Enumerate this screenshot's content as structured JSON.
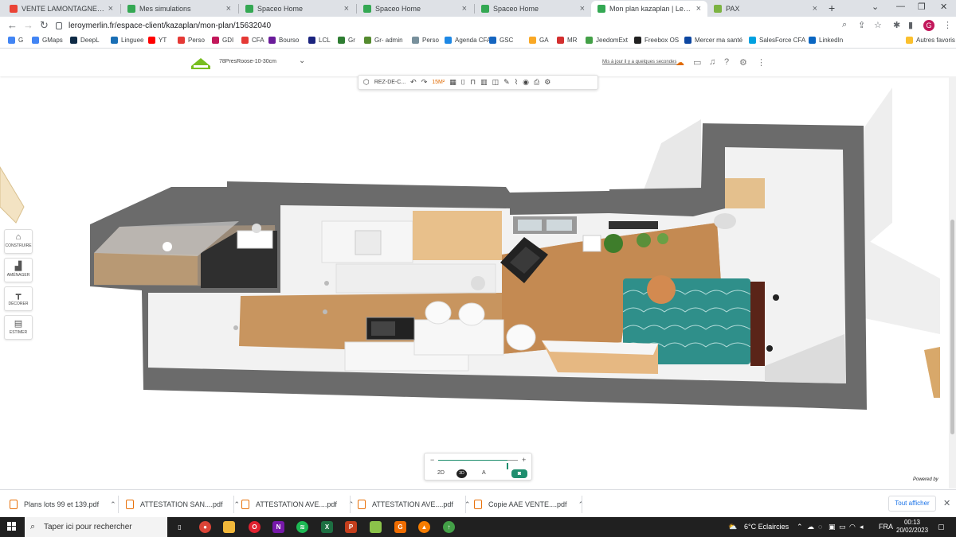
{
  "browser": {
    "tabs": [
      {
        "title": "VENTE LAMONTAGNE/GRAIGNIC",
        "favicon": "gmail-icon",
        "color": "#ea4335"
      },
      {
        "title": "Mes simulations",
        "favicon": "page-icon",
        "color": "#34a853"
      },
      {
        "title": "Spaceo Home",
        "favicon": "page-icon",
        "color": "#34a853"
      },
      {
        "title": "Spaceo Home",
        "favicon": "page-icon",
        "color": "#34a853"
      },
      {
        "title": "Spaceo Home",
        "favicon": "page-icon",
        "color": "#34a853"
      },
      {
        "title": "Mon plan kazaplan | Leroy Merl",
        "favicon": "page-icon",
        "color": "#34a853"
      },
      {
        "title": "PAX",
        "favicon": "pax-icon",
        "color": "#7cb342"
      }
    ],
    "url": "leroymerlin.fr/espace-client/kazaplan/mon-plan/15632040",
    "bookmarks": [
      {
        "label": "G",
        "color": "#4285f4"
      },
      {
        "label": "GMaps",
        "color": "#4285f4"
      },
      {
        "label": "DeepL",
        "color": "#0f2b46"
      },
      {
        "label": "Linguee",
        "color": "#1a6fb5"
      },
      {
        "label": "YT",
        "color": "#ff0000"
      },
      {
        "label": "Perso",
        "color": "#e53935"
      },
      {
        "label": "GDI",
        "color": "#c2185b"
      },
      {
        "label": "CFA",
        "color": "#e53935"
      },
      {
        "label": "Bourso",
        "color": "#6a1b9a"
      },
      {
        "label": "LCL",
        "color": "#1a237e"
      },
      {
        "label": "Gr",
        "color": "#2e7d32"
      },
      {
        "label": "Gr- admin",
        "color": "#558b2f"
      },
      {
        "label": "Perso",
        "color": "#78909c"
      },
      {
        "label": "Agenda CFA",
        "color": "#1e88e5"
      },
      {
        "label": "GSC",
        "color": "#1565c0"
      },
      {
        "label": "GA",
        "color": "#f9a825"
      },
      {
        "label": "MR",
        "color": "#d32f2f"
      },
      {
        "label": "JeedomExt",
        "color": "#43a047"
      },
      {
        "label": "Freebox OS",
        "color": "#212121"
      },
      {
        "label": "Mercer ma santé",
        "color": "#0d47a1"
      },
      {
        "label": "SalesForce CFA",
        "color": "#00a1e0"
      },
      {
        "label": "LinkedIn",
        "color": "#0a66c2"
      },
      {
        "label": "Autres favoris",
        "color": "#fbc02d"
      }
    ]
  },
  "app": {
    "plan_name": "78PresRoose-10-30cm",
    "saved_text": "Mis à jour il y a quelques secondes",
    "level": "REZ-DE-C...",
    "surface": "15M²",
    "menu": [
      {
        "label": "CONSTRUIRE",
        "icon": "house-icon"
      },
      {
        "label": "AMÉNAGER",
        "icon": "sofa-icon"
      },
      {
        "label": "DÉCORER",
        "icon": "paint-roller-icon"
      },
      {
        "label": "ESTIMER",
        "icon": "clipboard-icon"
      }
    ],
    "view": {
      "btn_2d": "2D",
      "btn_3d": "3D",
      "btn_text": "A",
      "zoom_level": 0.87
    },
    "powered_by": "Powered by"
  },
  "downloads": {
    "items": [
      "Plans lots 99 et 139.pdf",
      "ATTESTATION SAN....pdf",
      "ATTESTATION AVE....pdf",
      "ATTESTATION AVE....pdf",
      "Copie AAE VENTE....pdf"
    ],
    "show_all": "Tout afficher"
  },
  "taskbar": {
    "search_placeholder": "Taper ici pour rechercher",
    "weather": "6°C  Eclaircies",
    "lang": "FRA",
    "time": "00:13",
    "date": "20/02/2023"
  },
  "colors": {
    "accent": "#1e8e6e",
    "wall": "#6b6b6b",
    "floor_wood": "#c8955f",
    "sofa": "#2f8f8a"
  }
}
